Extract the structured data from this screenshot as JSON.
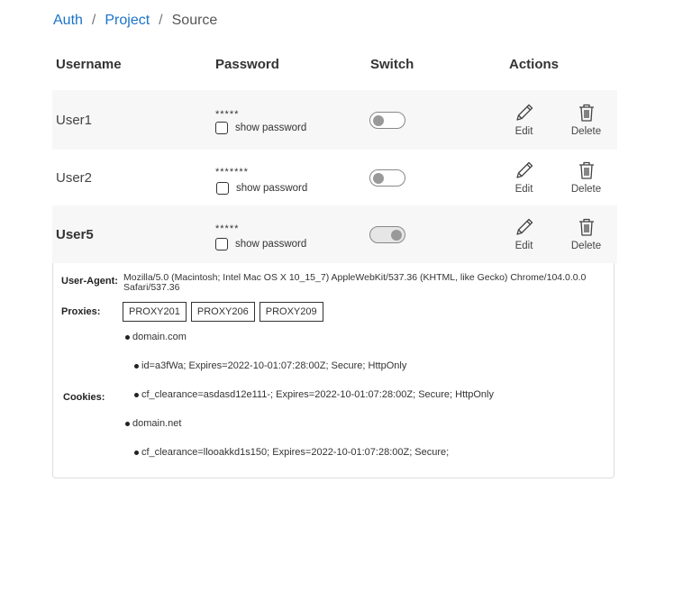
{
  "breadcrumb": {
    "items": [
      "Auth",
      "Project"
    ],
    "separator": "/",
    "current": "Source"
  },
  "table": {
    "headers": {
      "username": "Username",
      "password": "Password",
      "switch": "Switch",
      "actions": "Actions"
    },
    "show_password_label": "show password",
    "edit_label": "Edit",
    "delete_label": "Delete",
    "rows": [
      {
        "username": "User1",
        "password_mask": "*****",
        "switch_on": false
      },
      {
        "username": "User2",
        "password_mask": "*******",
        "switch_on": false
      },
      {
        "username": "User5",
        "password_mask": "*****",
        "switch_on": true
      }
    ]
  },
  "details": {
    "user_agent_label": "User-Agent:",
    "user_agent": "Mozilla/5.0 (Macintosh; Intel Mac OS X 10_15_7) AppleWebKit/537.36 (KHTML, like Gecko) Chrome/104.0.0.0 Safari/537.36",
    "proxies_label": "Proxies:",
    "proxies": [
      "PROXY201",
      "PROXY206",
      "PROXY209"
    ],
    "cookies_label": "Cookies:",
    "cookies": [
      {
        "domain": "domain.com",
        "items": [
          "id=a3fWa; Expires=2022-10-01:07:28:00Z; Secure; HttpOnly",
          "cf_clearance=asdasd12e111-; Expires=2022-10-01:07:28:00Z; Secure; HttpOnly"
        ]
      },
      {
        "domain": "domain.net",
        "items": [
          "cf_clearance=llooakkd1s150; Expires=2022-10-01:07:28:00Z; Secure;"
        ]
      }
    ]
  },
  "colors": {
    "link": "#1a73c8",
    "row_shade": "#f7f7f7"
  }
}
